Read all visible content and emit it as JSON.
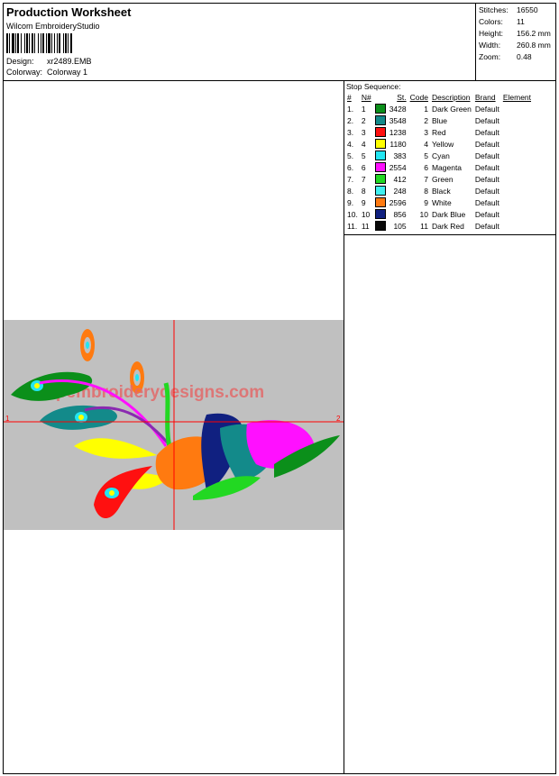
{
  "header": {
    "title": "Production Worksheet",
    "software": "Wilcom EmbroideryStudio",
    "design_label": "Design:",
    "design_value": "xr2489.EMB",
    "colorway_label": "Colorway:",
    "colorway_value": "Colorway 1"
  },
  "stats": [
    {
      "label": "Stitches:",
      "value": "16550"
    },
    {
      "label": "Colors:",
      "value": "11"
    },
    {
      "label": "Height:",
      "value": "156.2 mm"
    },
    {
      "label": "Width:",
      "value": "260.8 mm"
    },
    {
      "label": "Zoom:",
      "value": "0.48"
    }
  ],
  "preview": {
    "watermark": "topembroiderydesigns.com",
    "marker_left": "1",
    "marker_right": "2",
    "background": "#c0c0c0",
    "crosshair_color": "#ff0000"
  },
  "stop_sequence": {
    "title": "Stop Sequence:",
    "columns": [
      "#",
      "N#",
      "St.",
      "Code",
      "Description",
      "Brand",
      "Element"
    ],
    "rows": [
      {
        "n": "1.",
        "nn": "1",
        "color": "#0b8f1a",
        "st": "3428",
        "code": "1",
        "desc": "Dark Green",
        "brand": "Default",
        "element": ""
      },
      {
        "n": "2.",
        "nn": "2",
        "color": "#138a8a",
        "st": "3548",
        "code": "2",
        "desc": "Blue",
        "brand": "Default",
        "element": ""
      },
      {
        "n": "3.",
        "nn": "3",
        "color": "#ff1010",
        "st": "1238",
        "code": "3",
        "desc": "Red",
        "brand": "Default",
        "element": ""
      },
      {
        "n": "4.",
        "nn": "4",
        "color": "#ffff00",
        "st": "1180",
        "code": "4",
        "desc": "Yellow",
        "brand": "Default",
        "element": ""
      },
      {
        "n": "5.",
        "nn": "5",
        "color": "#22e6f2",
        "st": "383",
        "code": "5",
        "desc": "Cyan",
        "brand": "Default",
        "element": ""
      },
      {
        "n": "6.",
        "nn": "6",
        "color": "#ff10ff",
        "st": "2554",
        "code": "6",
        "desc": "Magenta",
        "brand": "Default",
        "element": ""
      },
      {
        "n": "7.",
        "nn": "7",
        "color": "#22d822",
        "st": "412",
        "code": "7",
        "desc": "Green",
        "brand": "Default",
        "element": ""
      },
      {
        "n": "8.",
        "nn": "8",
        "color": "#40f0f0",
        "st": "248",
        "code": "8",
        "desc": "Black",
        "brand": "Default",
        "element": ""
      },
      {
        "n": "9.",
        "nn": "9",
        "color": "#ff7a10",
        "st": "2596",
        "code": "9",
        "desc": "White",
        "brand": "Default",
        "element": ""
      },
      {
        "n": "10.",
        "nn": "10",
        "color": "#102080",
        "st": "856",
        "code": "10",
        "desc": "Dark Blue",
        "brand": "Default",
        "element": ""
      },
      {
        "n": "11.",
        "nn": "11",
        "color": "#080808",
        "st": "105",
        "code": "11",
        "desc": "Dark Red",
        "brand": "Default",
        "element": ""
      }
    ]
  }
}
